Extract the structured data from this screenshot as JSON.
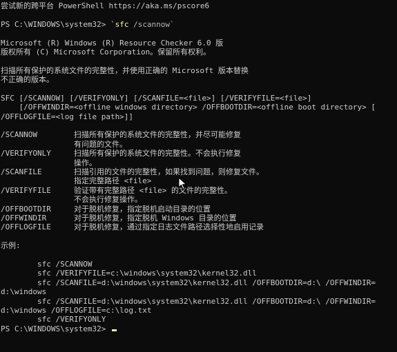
{
  "colors": {
    "background": "#0c0c0c",
    "foreground": "#cccccc",
    "command": "#f9f1a5",
    "parameter": "#b4b4b4",
    "cursor": "#f9f1a5"
  },
  "terminal": {
    "banner": "尝试新的跨平台 PowerShell https://aka.ms/pscore6",
    "prompt1": "PS C:\\WINDOWS\\system32> ",
    "command_name": "`sfc",
    "command_args": " /scannow`",
    "output": [
      "Microsoft (R) Windows (R) Resource Checker 6.0 版",
      "版权所有 (C) Microsoft Corporation。保留所有权利。",
      "",
      "扫描所有保护的系统文件的完整性，并使用正确的 Microsoft 版本替换",
      "不正确的版本。",
      "",
      "SFC [/SCANNOW] [/VERIFYONLY] [/SCANFILE=<file>] [/VERIFYFILE=<file>]",
      "    [/OFFWINDIR=<offline windows directory> /OFFBOOTDIR=<offline boot directory> [",
      "/OFFLOGFILE=<log file path>]]",
      "",
      "/SCANNOW        扫描所有保护的系统文件的完整性，并尽可能修复",
      "                有问题的文件。",
      "/VERIFYONLY     扫描所有保护的系统文件的完整性。不会执行修复",
      "                操作。",
      "/SCANFILE       扫描引用的文件的完整性，如果找到问题，则修复文件。",
      "                指定完整路径 <file>",
      "/VERIFYFILE     验证带有完整路径 <file> 的文件的完整性。",
      "                不会执行修复操作。",
      "/OFFBOOTDIR     对于脱机修复，指定脱机启动目录的位置",
      "/OFFWINDIR      对于脱机修复，指定脱机 Windows 目录的位置",
      "/OFFLOGFILE     对于脱机修复，通过指定日志文件路径选择性地启用记录",
      "",
      "示例:",
      "",
      "        sfc /SCANNOW",
      "        sfc /VERIFYFILE=c:\\windows\\system32\\kernel32.dll",
      "        sfc /SCANFILE=d:\\windows\\system32\\kernel32.dll /OFFBOOTDIR=d:\\ /OFFWINDIR=",
      "d:\\windows",
      "        sfc /SCANFILE=d:\\windows\\system32\\kernel32.dll /OFFBOOTDIR=d:\\ /OFFWINDIR=",
      "d:\\windows /OFFLOGFILE=c:\\log.txt",
      "        sfc /VERIFYONLY"
    ],
    "prompt2": "PS C:\\WINDOWS\\system32> "
  }
}
